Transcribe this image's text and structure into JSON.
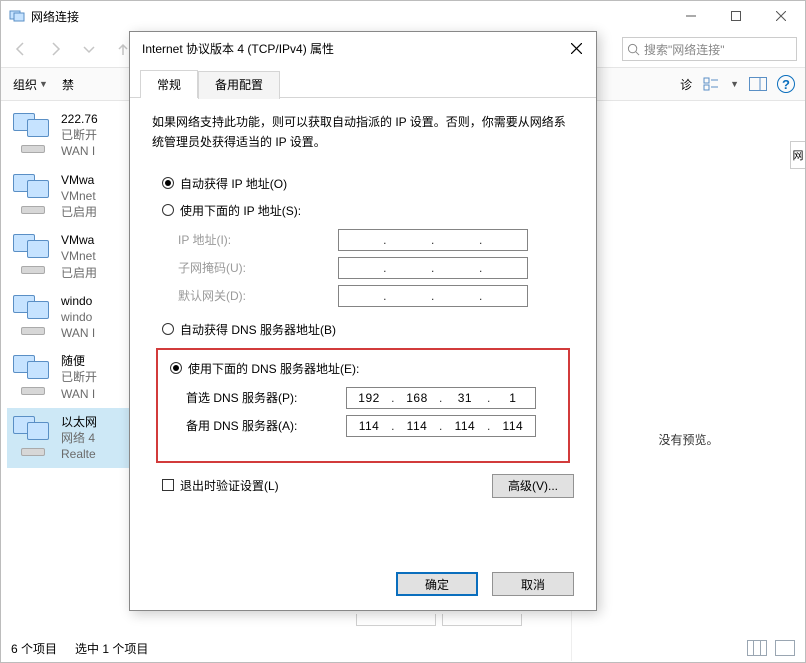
{
  "window": {
    "title": "网络连接",
    "search_placeholder": "搜索\"网络连接\""
  },
  "toolbar": {
    "organize": "组织",
    "disable": "禁",
    "diagnose": "诊"
  },
  "preview": {
    "none": "没有预览。"
  },
  "side_sliver": "网",
  "connections": [
    {
      "name": "222.76",
      "status": "已断开",
      "adapter": "WAN I"
    },
    {
      "name": "VMwa",
      "status": "VMnet",
      "adapter": "已启用"
    },
    {
      "name": "VMwa",
      "status": "VMnet",
      "adapter": "已启用"
    },
    {
      "name": "windo",
      "status": "windo",
      "adapter": "WAN I"
    },
    {
      "name": "随便",
      "status": "已断开",
      "adapter": "WAN I"
    },
    {
      "name": "以太网",
      "status": "网络 4",
      "adapter": "Realte"
    }
  ],
  "status": {
    "count": "6 个项目",
    "selected": "选中 1 个项目"
  },
  "dialog": {
    "title": "Internet 协议版本 4 (TCP/IPv4) 属性",
    "tabs": {
      "general": "常规",
      "alternate": "备用配置"
    },
    "intro": "如果网络支持此功能，则可以获取自动指派的 IP 设置。否则，你需要从网络系统管理员处获得适当的 IP 设置。",
    "ip": {
      "auto": "自动获得 IP 地址(O)",
      "manual": "使用下面的 IP 地址(S):",
      "addr_label": "IP 地址(I):",
      "mask_label": "子网掩码(U):",
      "gw_label": "默认网关(D):"
    },
    "dns": {
      "auto": "自动获得 DNS 服务器地址(B)",
      "manual": "使用下面的 DNS 服务器地址(E):",
      "primary_label": "首选 DNS 服务器(P):",
      "alt_label": "备用 DNS 服务器(A):",
      "primary": [
        "192",
        "168",
        "31",
        "1"
      ],
      "alt": [
        "114",
        "114",
        "114",
        "114"
      ]
    },
    "validate": "退出时验证设置(L)",
    "advanced": "高级(V)...",
    "ok": "确定",
    "cancel": "取消"
  }
}
